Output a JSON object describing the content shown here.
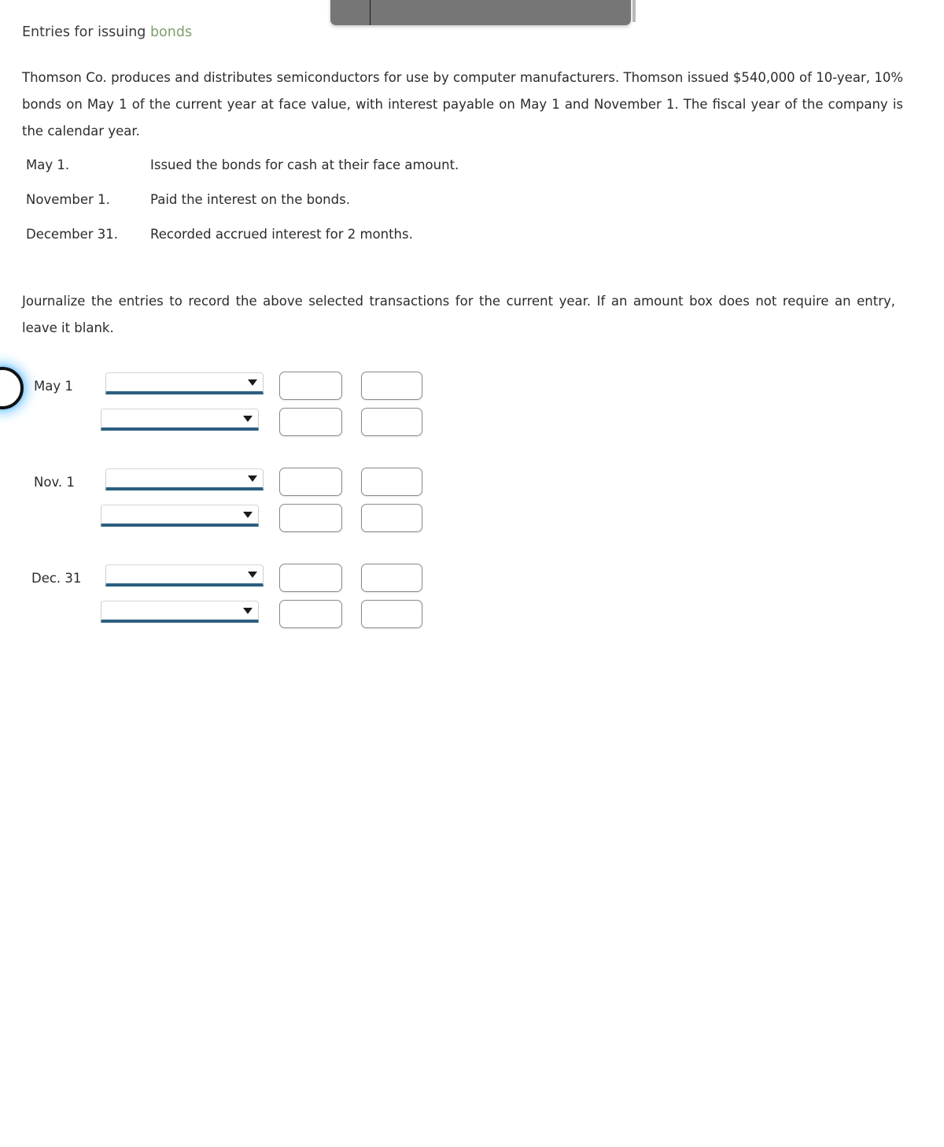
{
  "page": {
    "title_prefix": "Entries for issuing ",
    "title_keyword": "bonds",
    "accent_keyword_color": "#7fa06e",
    "underline_color": "#2c5f80",
    "toolbar_color": "#767676"
  },
  "intro": {
    "paragraph": "Thomson Co. produces and distributes semiconductors for use by computer manufacturers. Thomson issued $540,000 of 10-year, 10% bonds on May 1 of the current year at face value, with interest payable on May 1 and November 1. The fiscal year of the company is the calendar year."
  },
  "transactions": [
    {
      "date": "May 1.",
      "description": "Issued the bonds for cash at their face amount."
    },
    {
      "date": "November 1.",
      "description": "Paid the interest on the bonds."
    },
    {
      "date": "December 31.",
      "description": "Recorded accrued interest for 2 months."
    }
  ],
  "instruction": {
    "paragraph": "Journalize the entries to record the above selected transactions for the current year. If an amount box does not require an entry, leave it blank."
  },
  "journal": {
    "rows": [
      {
        "date": "May 1",
        "lines": [
          {
            "account": "",
            "debit": "",
            "credit": ""
          },
          {
            "account": "",
            "debit": "",
            "credit": ""
          }
        ]
      },
      {
        "date": "Nov. 1",
        "lines": [
          {
            "account": "",
            "debit": "",
            "credit": ""
          },
          {
            "account": "",
            "debit": "",
            "credit": ""
          }
        ]
      },
      {
        "date": "Dec. 31",
        "lines": [
          {
            "account": "",
            "debit": "",
            "credit": ""
          },
          {
            "account": "",
            "debit": "",
            "credit": ""
          }
        ]
      }
    ]
  }
}
